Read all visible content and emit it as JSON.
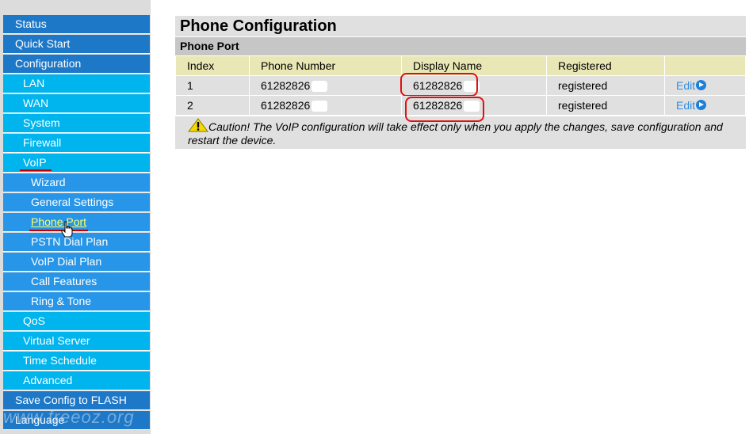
{
  "sidebar": {
    "items": [
      {
        "label": "Status",
        "level": 0
      },
      {
        "label": "Quick Start",
        "level": 0
      },
      {
        "label": "Configuration",
        "level": 0
      },
      {
        "label": "LAN",
        "level": 1
      },
      {
        "label": "WAN",
        "level": 1
      },
      {
        "label": "System",
        "level": 1
      },
      {
        "label": "Firewall",
        "level": 1
      },
      {
        "label": "VoIP",
        "level": 1
      },
      {
        "label": "Wizard",
        "level": 2
      },
      {
        "label": "General Settings",
        "level": 2
      },
      {
        "label": "Phone Port",
        "level": 2
      },
      {
        "label": "PSTN Dial Plan",
        "level": 2
      },
      {
        "label": "VoIP Dial Plan",
        "level": 2
      },
      {
        "label": "Call Features",
        "level": 2
      },
      {
        "label": "Ring & Tone",
        "level": 2
      },
      {
        "label": "QoS",
        "level": 1
      },
      {
        "label": "Virtual Server",
        "level": 1
      },
      {
        "label": "Time Schedule",
        "level": 1
      },
      {
        "label": "Advanced",
        "level": 1
      },
      {
        "label": "Save Config to FLASH",
        "level": 0
      },
      {
        "label": "Language",
        "level": 0
      }
    ],
    "watermark": "www.freeoz.org"
  },
  "main": {
    "title": "Phone Configuration",
    "section": "Phone Port",
    "table": {
      "headers": [
        "Index",
        "Phone Number",
        "Display Name",
        "Registered",
        ""
      ],
      "rows": [
        {
          "index": "1",
          "phone": "61282826",
          "display": "61282826",
          "registered": "registered",
          "action": "Edit"
        },
        {
          "index": "2",
          "phone": "61282826",
          "display": "61282826",
          "registered": "registered",
          "action": "Edit"
        }
      ]
    },
    "caution": "Caution! The VoIP configuration will take effect only when you apply the changes, save configuration and restart the device."
  },
  "colors": {
    "nav_level0": "#1e78c8",
    "nav_level1": "#00b4ee",
    "nav_level2": "#2896e8",
    "header_row": "#e9e7b5",
    "annotation_red": "#e01010"
  }
}
